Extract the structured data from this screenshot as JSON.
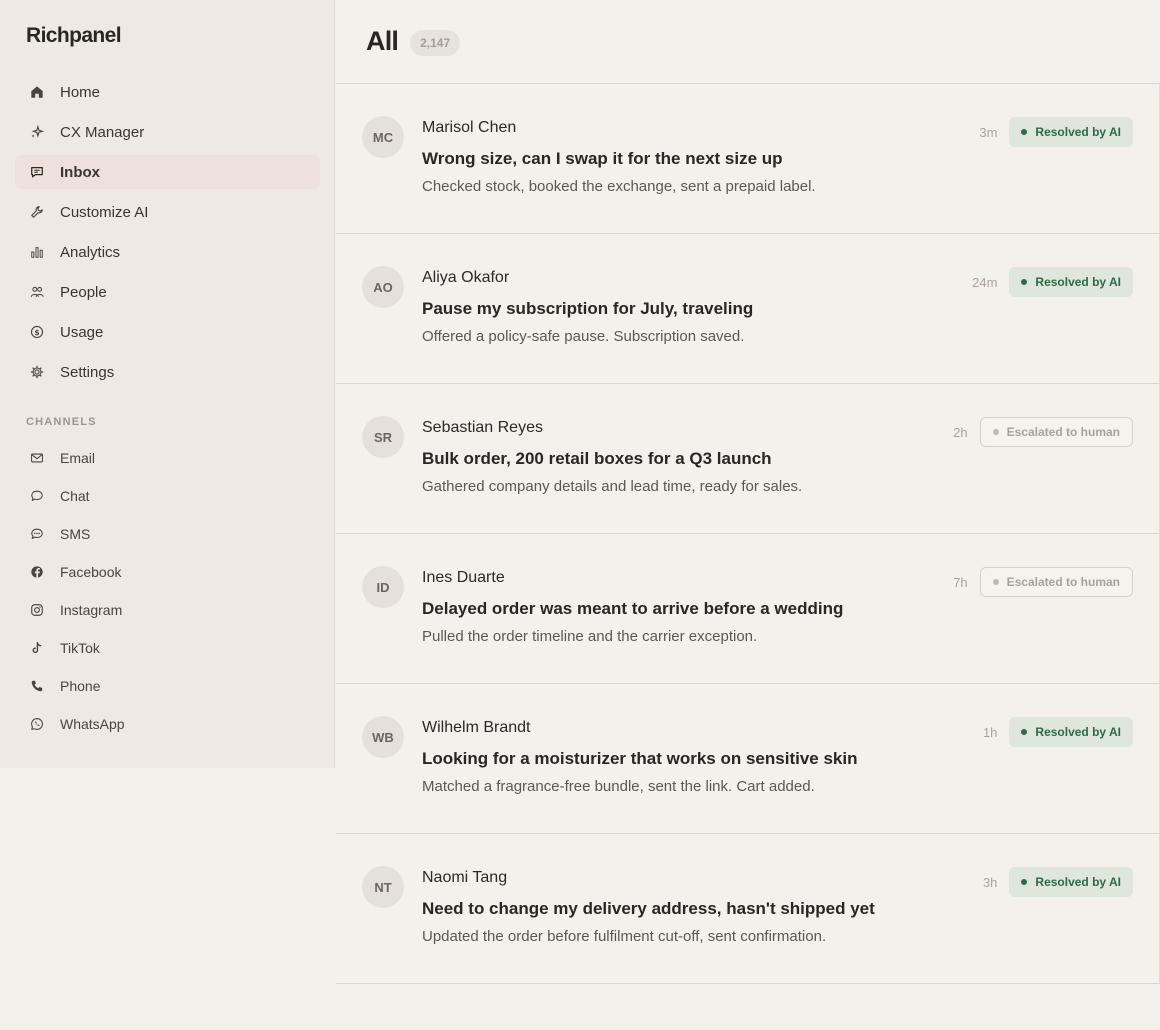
{
  "brand": "Richpanel",
  "nav": [
    {
      "label": "Home",
      "icon": "home-icon"
    },
    {
      "label": "CX Manager",
      "icon": "sparkle-icon"
    },
    {
      "label": "Inbox",
      "icon": "message-icon",
      "active": true
    },
    {
      "label": "Customize AI",
      "icon": "wrench-icon"
    },
    {
      "label": "Analytics",
      "icon": "bar-chart-icon"
    },
    {
      "label": "People",
      "icon": "people-icon"
    },
    {
      "label": "Usage",
      "icon": "dollar-icon"
    },
    {
      "label": "Settings",
      "icon": "gear-icon"
    }
  ],
  "channels_label": "CHANNELS",
  "channels": [
    {
      "label": "Email",
      "icon": "mail-icon"
    },
    {
      "label": "Chat",
      "icon": "chat-bubble-icon"
    },
    {
      "label": "SMS",
      "icon": "sms-icon"
    },
    {
      "label": "Facebook",
      "icon": "facebook-icon"
    },
    {
      "label": "Instagram",
      "icon": "instagram-icon"
    },
    {
      "label": "TikTok",
      "icon": "tiktok-icon"
    },
    {
      "label": "Phone",
      "icon": "phone-icon"
    },
    {
      "label": "WhatsApp",
      "icon": "whatsapp-icon"
    }
  ],
  "main": {
    "title": "All",
    "count": "2,147"
  },
  "conversations": [
    {
      "initials": "MC",
      "name": "Marisol Chen",
      "subject": "Wrong size, can I swap it for the next size up",
      "summary": "Checked stock, booked the exchange, sent a prepaid label.",
      "time": "3m",
      "status": "Resolved by AI",
      "status_type": "resolved"
    },
    {
      "initials": "AO",
      "name": "Aliya Okafor",
      "subject": "Pause my subscription for July, traveling",
      "summary": "Offered a policy-safe pause. Subscription saved.",
      "time": "24m",
      "status": "Resolved by AI",
      "status_type": "resolved"
    },
    {
      "initials": "SR",
      "name": "Sebastian Reyes",
      "subject": "Bulk order, 200 retail boxes for a Q3 launch",
      "summary": "Gathered company details and lead time, ready for sales.",
      "time": "2h",
      "status": "Escalated to human",
      "status_type": "escalated"
    },
    {
      "initials": "ID",
      "name": "Ines Duarte",
      "subject": "Delayed order was meant to arrive before a wedding",
      "summary": "Pulled the order timeline and the carrier exception.",
      "time": "7h",
      "status": "Escalated to human",
      "status_type": "escalated"
    },
    {
      "initials": "WB",
      "name": "Wilhelm Brandt",
      "subject": "Looking for a moisturizer that works on sensitive skin",
      "summary": "Matched a fragrance-free bundle, sent the link. Cart added.",
      "time": "1h",
      "status": "Resolved by AI",
      "status_type": "resolved"
    },
    {
      "initials": "NT",
      "name": "Naomi Tang",
      "subject": "Need to change my delivery address, hasn't shipped yet",
      "summary": "Updated the order before fulfilment cut-off, sent confirmation.",
      "time": "3h",
      "status": "Resolved by AI",
      "status_type": "resolved"
    }
  ]
}
